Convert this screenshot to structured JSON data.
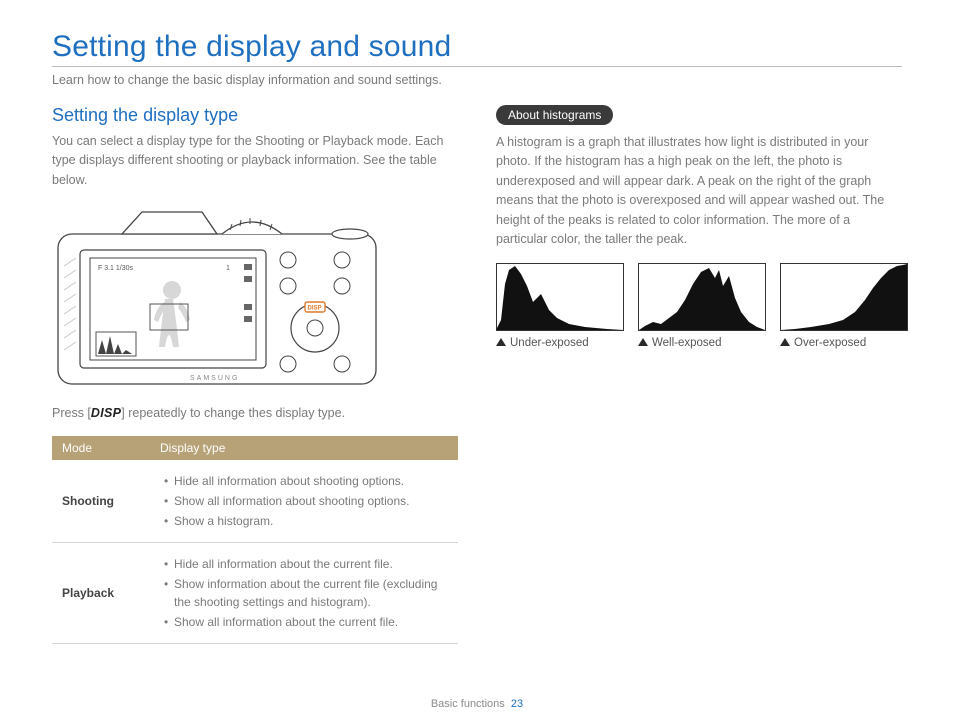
{
  "title": "Setting the display and sound",
  "intro": "Learn how to change the basic display information and sound settings.",
  "left": {
    "heading": "Setting the display type",
    "body": "You can select a display type for the Shooting or Playback mode. Each type displays different shooting or playback information. See the table below.",
    "press_pre": "Press [",
    "press_btn": "DISP",
    "press_post": "] repeatedly to change thes display type.",
    "table": {
      "headers": [
        "Mode",
        "Display type"
      ],
      "rows": [
        {
          "mode": "Shooting",
          "items": [
            "Hide all information about shooting options.",
            "Show all information about shooting options.",
            "Show a histogram."
          ]
        },
        {
          "mode": "Playback",
          "items": [
            "Hide all information about the current file.",
            "Show information about the current file (excluding the shooting settings and histogram).",
            "Show all information about the current file."
          ]
        }
      ]
    }
  },
  "right": {
    "pill": "About histograms",
    "body": "A histogram is a graph that illustrates how light is distributed in your photo. If the histogram has a high peak on the left, the photo is underexposed and will appear dark. A peak on the right of the graph means that the photo is overexposed and will appear washed out. The height of the peaks is related to color information. The more of a particular color, the taller the peak.",
    "histograms": [
      {
        "label": "Under-exposed"
      },
      {
        "label": "Well-exposed"
      },
      {
        "label": "Over-exposed"
      }
    ]
  },
  "camera": {
    "brand": "SAMSUNG",
    "disp_btn": "DISP",
    "lcd_top_text": "F 3.1  1/30s",
    "lcd_right_text": "1"
  },
  "footer": {
    "section": "Basic functions",
    "page": "23"
  }
}
